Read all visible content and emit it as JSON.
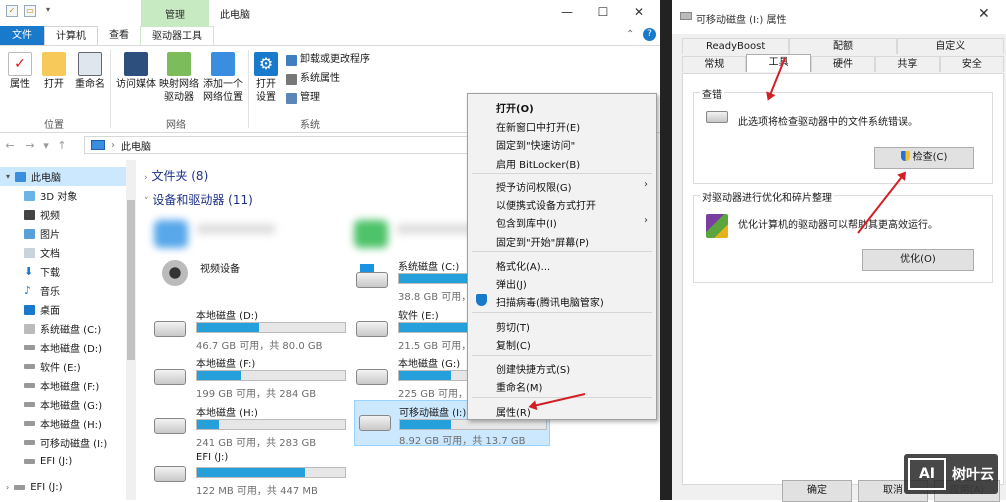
{
  "explorer": {
    "title": "此电脑",
    "context_tab": "管理",
    "tabs": [
      "文件",
      "计算机",
      "查看",
      "驱动器工具"
    ],
    "ribbon": {
      "location": {
        "label": "位置",
        "buttons": [
          "属性",
          "打开",
          "重命名"
        ]
      },
      "network": {
        "label": "网络",
        "buttons": [
          [
            "访问媒体"
          ],
          [
            "映射网络",
            "驱动器"
          ],
          [
            "添加一个",
            "网络位置"
          ]
        ]
      },
      "system": {
        "label": "系统",
        "open_settings": "打开\n设置",
        "items": [
          "卸载或更改程序",
          "系统属性",
          "管理"
        ]
      }
    },
    "address": "此电脑",
    "nav": [
      "此电脑",
      "3D 对象",
      "视频",
      "图片",
      "文档",
      "下载",
      "音乐",
      "桌面",
      "系统磁盘 (C:)",
      "本地磁盘 (D:)",
      "软件 (E:)",
      "本地磁盘 (F:)",
      "本地磁盘 (G:)",
      "本地磁盘 (H:)",
      "可移动磁盘 (I:)",
      "EFI (J:)",
      "EFI (J:)"
    ],
    "folders_header": "文件夹 (8)",
    "devices_header": "设备和驱动器 (11)",
    "video_device": "视频设备",
    "drives": [
      {
        "name": "系统磁盘 (C:)",
        "size": "38.8 GB 可用，共",
        "fill": 0.75
      },
      {
        "name": "本地磁盘 (D:)",
        "size": "46.7 GB 可用，共 80.0 GB",
        "fill": 0.42
      },
      {
        "name": "软件 (E:)",
        "size": "21.5 GB 可用，共",
        "fill": 0.8
      },
      {
        "name": "本地磁盘 (F:)",
        "size": "199 GB 可用，共 284 GB",
        "fill": 0.3
      },
      {
        "name": "本地磁盘 (G:)",
        "size": "225 GB 可用，共",
        "fill": 0.35
      },
      {
        "name": "本地磁盘 (H:)",
        "size": "241 GB 可用，共 283 GB",
        "fill": 0.15
      },
      {
        "name": "可移动磁盘 (I:)",
        "size": "8.92 GB 可用，共 13.7 GB",
        "fill": 0.35
      },
      {
        "name": "EFI (J:)",
        "size": "122 MB 可用，共 447 MB",
        "fill": 0.73
      }
    ]
  },
  "context_menu": {
    "items": [
      "打开(O)",
      "在新窗口中打开(E)",
      "固定到\"快速访问\"",
      "启用 BitLocker(B)",
      "授予访问权限(G)",
      "以便携式设备方式打开",
      "包含到库中(I)",
      "固定到\"开始\"屏幕(P)",
      "格式化(A)...",
      "弹出(J)",
      "扫描病毒(腾讯电脑管家)",
      "剪切(T)",
      "复制(C)",
      "创建快捷方式(S)",
      "重命名(M)",
      "属性(R)"
    ]
  },
  "dialog": {
    "title": "可移动磁盘 (I:) 属性",
    "tabs_row1": [
      "ReadyBoost",
      "配额",
      "自定义"
    ],
    "tabs_row2": [
      "常规",
      "工具",
      "硬件",
      "共享",
      "安全"
    ],
    "check_group": "查错",
    "check_text": "此选项将检查驱动器中的文件系统错误。",
    "check_button": "检查(C)",
    "opt_group": "对驱动器进行优化和碎片整理",
    "opt_text": "优化计算机的驱动器可以帮助其更高效运行。",
    "opt_button": "优化(O)",
    "ok": "确定",
    "cancel": "取消",
    "apply": "应用(A)"
  },
  "watermark": {
    "mark": "AI",
    "text": "树叶云"
  }
}
